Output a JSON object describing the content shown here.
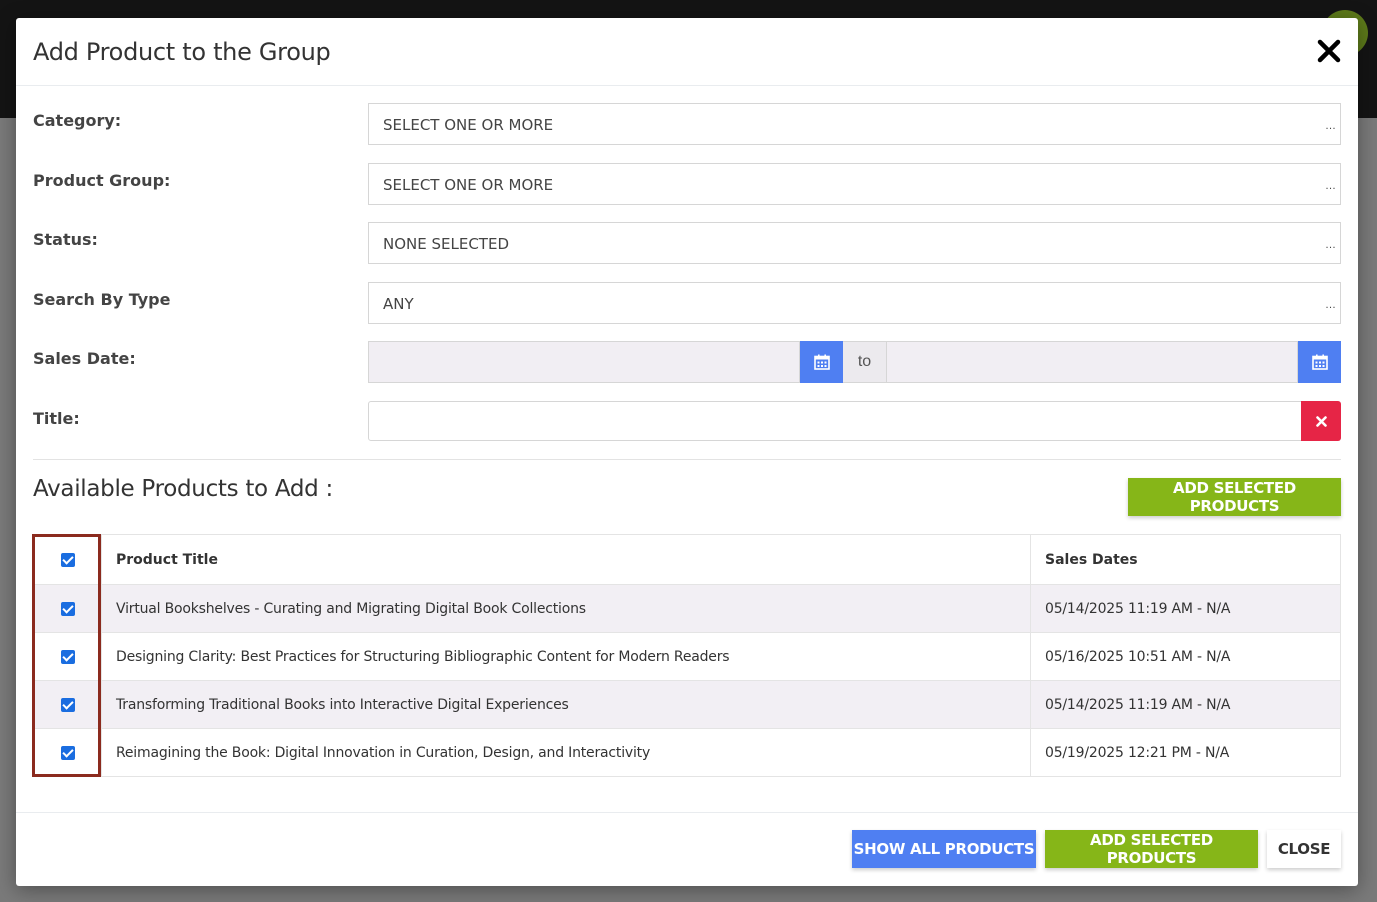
{
  "modal": {
    "title": "Add Product to the Group"
  },
  "filters": {
    "category_label": "Category:",
    "category_value": "SELECT ONE OR MORE",
    "product_group_label": "Product Group:",
    "product_group_value": "SELECT ONE OR MORE",
    "status_label": "Status:",
    "status_value": "NONE SELECTED",
    "search_by_type_label": "Search By Type",
    "search_by_type_value": "ANY",
    "sales_date_label": "Sales Date:",
    "sales_date_from": "",
    "sales_date_to": "",
    "to_label": "to",
    "title_label": "Title:",
    "title_value": ""
  },
  "products": {
    "section_title": "Available Products to Add :",
    "add_selected_label": "ADD SELECTED PRODUCTS",
    "columns": [
      "Product Title",
      "Sales Dates"
    ],
    "select_all_checked": true,
    "rows": [
      {
        "title": "Virtual Bookshelves - Curating and Migrating Digital Book Collections",
        "sales_dates": "05/14/2025 11:19 AM - N/A",
        "checked": true
      },
      {
        "title": "Designing Clarity: Best Practices for Structuring Bibliographic Content for Modern Readers",
        "sales_dates": "05/16/2025 10:51 AM - N/A",
        "checked": true
      },
      {
        "title": "Transforming Traditional Books into Interactive Digital Experiences",
        "sales_dates": "05/14/2025 11:19 AM - N/A",
        "checked": true
      },
      {
        "title": "Reimagining the Book: Digital Innovation in Curation, Design, and Interactivity",
        "sales_dates": "05/19/2025 12:21 PM - N/A",
        "checked": true
      }
    ]
  },
  "footer": {
    "show_all_label": "SHOW ALL PRODUCTS",
    "add_selected_label": "ADD SELECTED PRODUCTS",
    "close_label": "CLOSE"
  },
  "colors": {
    "primary_blue": "#4f7ff2",
    "accent_green": "#86b618",
    "danger_red": "#e62546",
    "highlight_border": "#8b2a1e"
  },
  "icons": {
    "close": "close-icon",
    "calendar": "calendar-icon",
    "clear": "times-icon"
  }
}
